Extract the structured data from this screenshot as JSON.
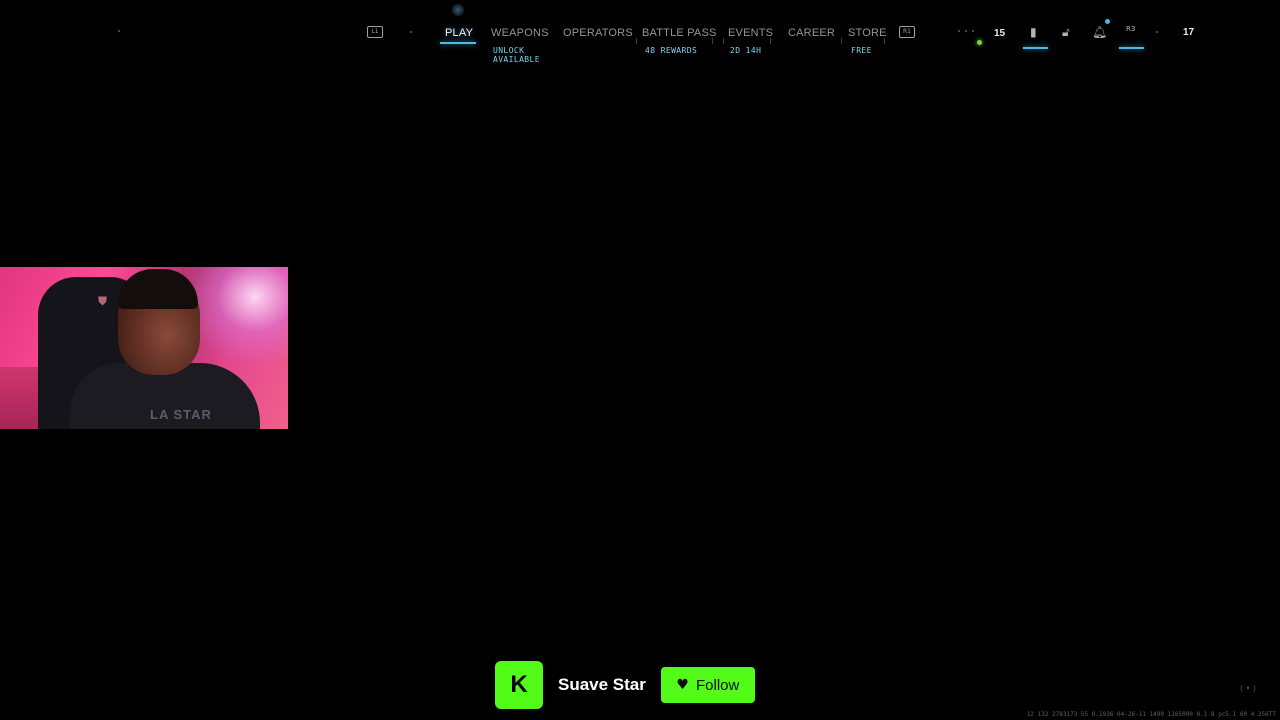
{
  "nav": {
    "left_button": "L1",
    "right_button": "R1",
    "tabs": [
      {
        "label": "PLAY",
        "active": true
      },
      {
        "label": "WEAPONS",
        "sub": "UNLOCK\nAVAILABLE"
      },
      {
        "label": "OPERATORS"
      },
      {
        "label": "BATTLE PASS",
        "sub": "48 REWARDS"
      },
      {
        "label": "EVENTS",
        "sub": "2D 14H"
      },
      {
        "label": "CAREER"
      },
      {
        "label": "STORE",
        "sub": "FREE"
      }
    ],
    "weapons_sub_line1": "UNLOCK",
    "weapons_sub_line2": "AVAILABLE"
  },
  "status": {
    "party_count": "15",
    "level": "17",
    "r3_label": "R3"
  },
  "webcam": {
    "shirt_text": "LA STAR"
  },
  "kick": {
    "logo_letter": "K",
    "channel_name": "Suave Star",
    "follow_label": "Follow"
  },
  "debug": {
    "text": "12 132 2783173 55 0.1936 04-26-11 1490 1165000 0.1 8 pc5 1 60 4 256TT"
  },
  "colors": {
    "accent": "#4fb8e8",
    "kick_green": "#53fc18",
    "online": "#7bd34a"
  }
}
